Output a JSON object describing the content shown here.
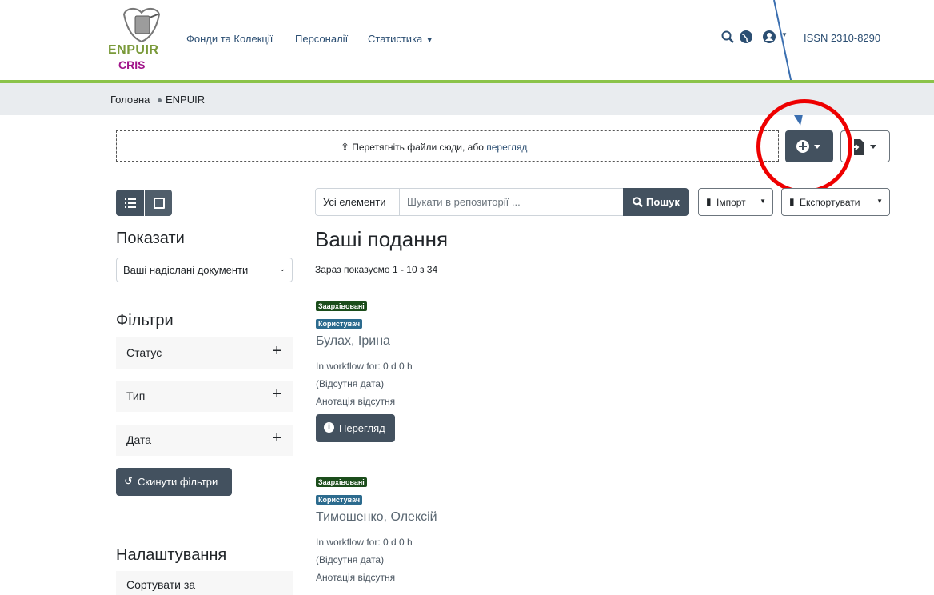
{
  "header": {
    "logo_text1": "ENPUIR",
    "logo_text2": "CRIS",
    "nav": [
      "Фонди та Колекції",
      "Персоналії",
      "Статистика"
    ],
    "issn": "ISSN 2310-8290"
  },
  "breadcrumb": [
    "Головна",
    "ENPUIR"
  ],
  "dropzone": {
    "text": "Перетягніть файли сюди, або",
    "link": "перегляд"
  },
  "sidebar": {
    "show_title": "Показати",
    "show_value": "Ваші надіслані документи",
    "filters_title": "Фільтри",
    "filters": [
      "Статус",
      "Тип",
      "Дата"
    ],
    "reset_label": "Скинути фільтри",
    "settings_title": "Налаштування",
    "sort_label": "Сортувати за"
  },
  "search": {
    "scope": "Усі елементи",
    "placeholder": "Шукати в репозиторії ...",
    "button": "Пошук",
    "import": "Імпорт",
    "export": "Експортувати"
  },
  "main": {
    "title": "Ваші подання",
    "count": "Зараз показуємо 1 - 10 з 34",
    "items": [
      {
        "badge1": "Заархівовані",
        "badge2": "Користувач",
        "name": "Булах, Ірина",
        "workflow": "In workflow for: 0 d 0 h",
        "date": "(Відсутня дата)",
        "abstract": "Анотація відсутня",
        "view": "Перегляд"
      },
      {
        "badge1": "Заархівовані",
        "badge2": "Користувач",
        "name": "Тимошенко, Олексій",
        "workflow": "In workflow for: 0 d 0 h",
        "date": "(Відсутня дата)",
        "abstract": "Анотація відсутня"
      }
    ]
  },
  "colors": {
    "accent_green": "#8bc34a",
    "dark_button": "#43515f",
    "annotation_red": "#e00000",
    "annotation_arrow": "#3b6fb0"
  }
}
